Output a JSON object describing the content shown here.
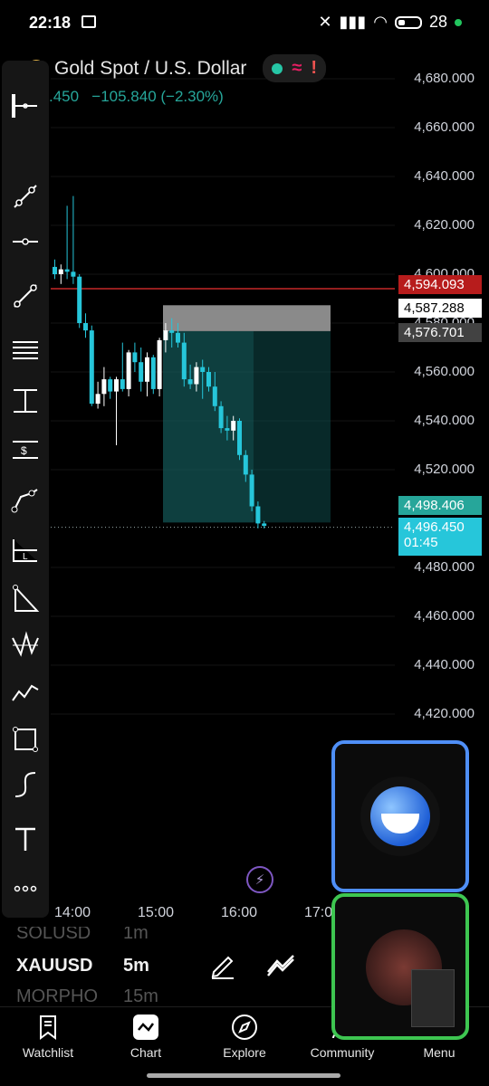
{
  "status": {
    "time": "22:18",
    "battery": "28"
  },
  "header": {
    "title": "Gold Spot / U.S. Dollar",
    "price_fragment": ".450",
    "change": "−105.840 (−2.30%)"
  },
  "price_axis": [
    "4,680.000",
    "4,660.000",
    "4,640.000",
    "4,620.000",
    "4,600.000",
    "4,580.000",
    "4,560.000",
    "4,540.000",
    "4,520.000",
    "4,480.000",
    "4,460.000",
    "4,440.000",
    "4,420.000"
  ],
  "price_tags": [
    {
      "value": "4,594.093",
      "color": "#b71c1c"
    },
    {
      "value": "4,587.288",
      "color": "#ffffff"
    },
    {
      "value": "4,576.701",
      "color": "#424242"
    },
    {
      "value": "4,498.406",
      "color": "#26a69a"
    },
    {
      "value": "4,496.450",
      "color": "#26c6da"
    }
  ],
  "countdown": "01:45",
  "time_axis": [
    "14:00",
    "15:00",
    "16:00",
    "17:0"
  ],
  "candles": [
    {
      "o": 4603,
      "h": 4606,
      "l": 4598,
      "c": 4600
    },
    {
      "o": 4600,
      "h": 4604,
      "l": 4596,
      "c": 4602
    },
    {
      "o": 4602,
      "h": 4628,
      "l": 4598,
      "c": 4601
    },
    {
      "o": 4601,
      "h": 4632,
      "l": 4596,
      "c": 4599
    },
    {
      "o": 4599,
      "h": 4600,
      "l": 4578,
      "c": 4580
    },
    {
      "o": 4580,
      "h": 4584,
      "l": 4574,
      "c": 4577
    },
    {
      "o": 4577,
      "h": 4579,
      "l": 4546,
      "c": 4547
    },
    {
      "o": 4547,
      "h": 4556,
      "l": 4545,
      "c": 4551
    },
    {
      "o": 4551,
      "h": 4562,
      "l": 4546,
      "c": 4557
    },
    {
      "o": 4557,
      "h": 4558,
      "l": 4549,
      "c": 4552
    },
    {
      "o": 4552,
      "h": 4558,
      "l": 4530,
      "c": 4557
    },
    {
      "o": 4557,
      "h": 4572,
      "l": 4552,
      "c": 4553
    },
    {
      "o": 4553,
      "h": 4569,
      "l": 4550,
      "c": 4568
    },
    {
      "o": 4568,
      "h": 4572,
      "l": 4560,
      "c": 4564
    },
    {
      "o": 4564,
      "h": 4570,
      "l": 4552,
      "c": 4556
    },
    {
      "o": 4556,
      "h": 4568,
      "l": 4550,
      "c": 4566
    },
    {
      "o": 4566,
      "h": 4567,
      "l": 4551,
      "c": 4553
    },
    {
      "o": 4553,
      "h": 4574,
      "l": 4550,
      "c": 4573
    },
    {
      "o": 4573,
      "h": 4580,
      "l": 4568,
      "c": 4577
    },
    {
      "o": 4577,
      "h": 4582,
      "l": 4570,
      "c": 4576
    },
    {
      "o": 4576,
      "h": 4580,
      "l": 4570,
      "c": 4572
    },
    {
      "o": 4572,
      "h": 4576,
      "l": 4554,
      "c": 4557
    },
    {
      "o": 4557,
      "h": 4563,
      "l": 4553,
      "c": 4555
    },
    {
      "o": 4555,
      "h": 4564,
      "l": 4552,
      "c": 4562
    },
    {
      "o": 4562,
      "h": 4565,
      "l": 4549,
      "c": 4560
    },
    {
      "o": 4560,
      "h": 4562,
      "l": 4552,
      "c": 4554
    },
    {
      "o": 4554,
      "h": 4560,
      "l": 4544,
      "c": 4546
    },
    {
      "o": 4546,
      "h": 4548,
      "l": 4535,
      "c": 4537
    },
    {
      "o": 4537,
      "h": 4542,
      "l": 4532,
      "c": 4536
    },
    {
      "o": 4536,
      "h": 4542,
      "l": 4532,
      "c": 4540
    },
    {
      "o": 4540,
      "h": 4541,
      "l": 4524,
      "c": 4526
    },
    {
      "o": 4526,
      "h": 4528,
      "l": 4515,
      "c": 4518
    },
    {
      "o": 4518,
      "h": 4520,
      "l": 4503,
      "c": 4505
    },
    {
      "o": 4505,
      "h": 4507,
      "l": 4496,
      "c": 4498
    },
    {
      "o": 4498,
      "h": 4499,
      "l": 4496,
      "c": 4497
    }
  ],
  "tools": [
    "cursor-icon",
    "trend-line-icon",
    "horizontal-line-icon",
    "ray-icon",
    "parallel-lines-icon",
    "fixed-range-icon",
    "price-range-icon",
    "path-icon",
    "long-position-icon",
    "triangle-icon",
    "pattern-icon",
    "wave-icon",
    "rectangle-icon",
    "curve-icon",
    "text-icon",
    "more-icon"
  ],
  "watchlist_strip": {
    "prev_symbol": "SOLUSD",
    "prev_tf": "1m",
    "symbol": "XAUUSD",
    "timeframe": "5m",
    "next_symbol": "MORPHO",
    "next_tf": "15m"
  },
  "nav": [
    {
      "label": "Watchlist",
      "icon": "watchlist-icon"
    },
    {
      "label": "Chart",
      "icon": "chart-icon"
    },
    {
      "label": "Explore",
      "icon": "compass-icon"
    },
    {
      "label": "Community",
      "icon": "community-icon"
    },
    {
      "label": "Menu",
      "icon": "menu-icon"
    }
  ]
}
